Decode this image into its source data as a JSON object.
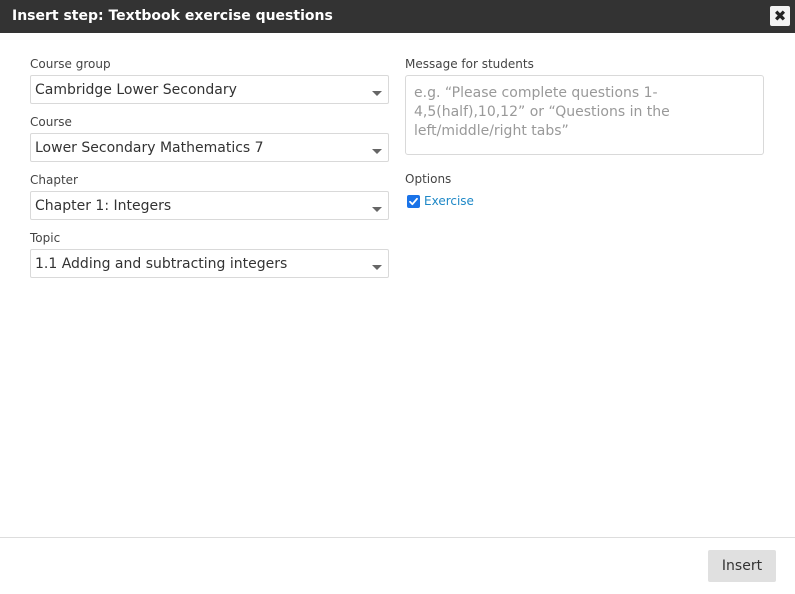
{
  "dialog": {
    "title": "Insert step: Textbook exercise questions",
    "close_symbol": "✖"
  },
  "fields": {
    "course_group": {
      "label": "Course group",
      "value": "Cambridge Lower Secondary"
    },
    "course": {
      "label": "Course",
      "value": "Lower Secondary Mathematics 7"
    },
    "chapter": {
      "label": "Chapter",
      "value": "Chapter 1: Integers"
    },
    "topic": {
      "label": "Topic",
      "value": "1.1 Adding and subtracting integers"
    }
  },
  "message": {
    "label": "Message for students",
    "placeholder": "e.g. “Please complete questions 1-4,5(half),10,12” or “Questions in the left/middle/right tabs”",
    "value": ""
  },
  "options": {
    "label": "Options",
    "items": [
      {
        "label": "Exercise",
        "checked": true
      }
    ]
  },
  "footer": {
    "insert_label": "Insert"
  },
  "colors": {
    "titlebar": "#333333",
    "checkbox": "#1a73e8",
    "option_text": "#1e88c7",
    "insert_button": "#e0e0e0"
  },
  "icons": {
    "close": "close-icon",
    "dropdown": "chevron-down-icon",
    "checkbox": "check-icon"
  }
}
